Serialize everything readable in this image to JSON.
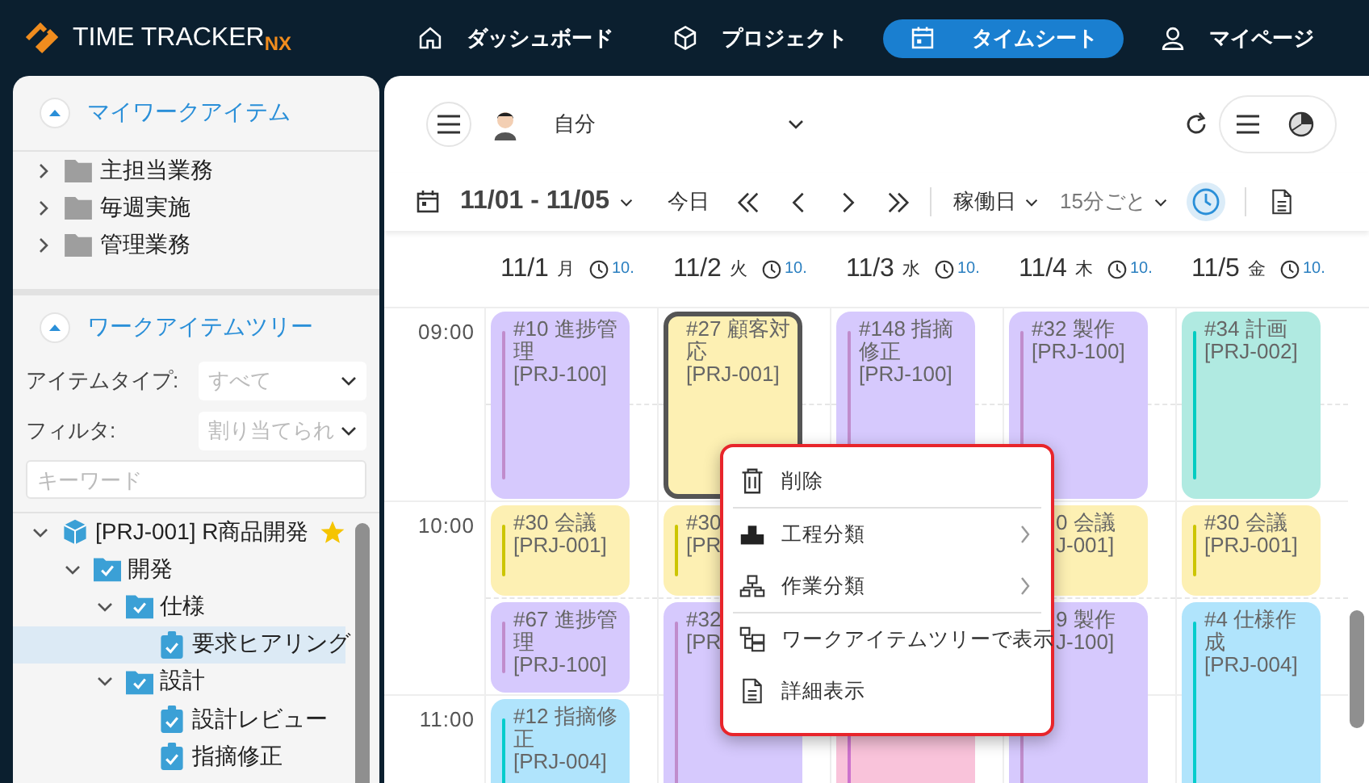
{
  "logo": {
    "name": "TIME TRACKER",
    "suffix": "NX"
  },
  "nav": [
    {
      "label": "ダッシュボード",
      "kind": "home",
      "selected": false
    },
    {
      "label": "プロジェクト",
      "kind": "cube",
      "selected": false
    },
    {
      "label": "タイムシート",
      "kind": "calendar",
      "selected": true
    },
    {
      "label": "マイページ",
      "kind": "user",
      "selected": false
    }
  ],
  "sidebar": {
    "my_items": {
      "title": "マイワークアイテム",
      "expanded": true,
      "items": [
        {
          "label": "主担当業務",
          "kind": "folder",
          "expanded": false
        },
        {
          "label": "毎週実施",
          "kind": "folder",
          "expanded": false
        },
        {
          "label": "管理業務",
          "kind": "folder",
          "expanded": false
        }
      ]
    },
    "tree": {
      "title": "ワークアイテムツリー",
      "expanded": true,
      "item_type": {
        "label": "アイテムタイプ:",
        "placeholder": "すべて"
      },
      "filter": {
        "label": "フィルタ:",
        "placeholder": "割り当てられ"
      },
      "keyword": {
        "placeholder": "キーワード"
      },
      "items": [
        {
          "label": "[PRJ-001] R商品開発",
          "kind": "project",
          "expanded": true,
          "favorite": true,
          "selected": false,
          "children": [
            {
              "label": "開発",
              "kind": "folder",
              "expanded": true,
              "favorite": false,
              "selected": false,
              "children": [
                {
                  "label": "仕様",
                  "kind": "folder",
                  "expanded": true,
                  "favorite": false,
                  "selected": false,
                  "children": [
                    {
                      "label": "要求ヒアリング",
                      "kind": "task",
                      "favorite": false,
                      "selected": true
                    }
                  ]
                },
                {
                  "label": "設計",
                  "kind": "folder",
                  "expanded": true,
                  "favorite": false,
                  "selected": false,
                  "children": [
                    {
                      "label": "設計レビュー",
                      "kind": "task",
                      "favorite": false,
                      "selected": false
                    },
                    {
                      "label": "指摘修正",
                      "kind": "task",
                      "favorite": false,
                      "selected": false
                    }
                  ]
                }
              ]
            }
          ]
        }
      ]
    }
  },
  "toolbar": {
    "user": "自分",
    "range": "11/01 - 11/05",
    "today": "今日",
    "days_mode": "稼働日",
    "interval": "15分ごと",
    "time_view_on": true
  },
  "calendar": {
    "times": [
      "09:00",
      "10:00",
      "11:00"
    ],
    "days": [
      {
        "date": "11/1",
        "weekday": "月",
        "total": "10.",
        "events": [
          {
            "title": "#10 進捗管理",
            "code": "[PRJ-100]",
            "color": "#d6c9fd",
            "kind": "hour",
            "selected": false
          },
          {
            "title": "#30 会議",
            "code": "[PRJ-001]",
            "color": "#fdf0b3",
            "kind": "half",
            "selected": false
          },
          {
            "title": "#67 進捗管理",
            "code": "[PRJ-100]",
            "color": "#d6c9fd",
            "kind": "half",
            "selected": false
          },
          {
            "title": "#12 指摘修正",
            "code": "[PRJ-004]",
            "color": "#b0e4fc",
            "kind": "hour",
            "selected": false
          }
        ]
      },
      {
        "date": "11/2",
        "weekday": "火",
        "total": "10.",
        "events": [
          {
            "title": "#27 顧客対応",
            "code": "[PRJ-001]",
            "color": "#fdf0b3",
            "kind": "hour",
            "selected": true
          },
          {
            "title": "#30",
            "code": "[PR",
            "color": "#fdf0b3",
            "kind": "half",
            "selected": false
          },
          {
            "title": "#32",
            "code": "[PR",
            "color": "#d6c9fd",
            "kind": "long",
            "selected": false
          }
        ]
      },
      {
        "date": "11/3",
        "weekday": "水",
        "total": "10.",
        "events": [
          {
            "title": "#148 指摘修正",
            "code": "[PRJ-100]",
            "color": "#d6c9fd",
            "kind": "hour",
            "selected": false
          },
          {
            "color": "#f9c3da",
            "kind": "long",
            "selected": false
          }
        ]
      },
      {
        "date": "11/4",
        "weekday": "木",
        "total": "10.",
        "events": [
          {
            "title": "#32 製作",
            "code": "[PRJ-100]",
            "color": "#d6c9fd",
            "kind": "hour",
            "selected": false
          },
          {
            "title": "0 会議",
            "code": "J-001]",
            "color": "#fdf0b3",
            "kind": "half",
            "selected": false,
            "covered": true
          },
          {
            "title": "9 製作",
            "code": "J-100]",
            "color": "#d6c9fd",
            "kind": "long",
            "selected": false,
            "covered": true
          }
        ]
      },
      {
        "date": "11/5",
        "weekday": "金",
        "total": "10.",
        "events": [
          {
            "title": "#34 計画",
            "code": "[PRJ-002]",
            "color": "#b0eae1",
            "kind": "hour",
            "selected": false
          },
          {
            "title": "#30 会議",
            "code": "[PRJ-001]",
            "color": "#fdf0b3",
            "kind": "half",
            "selected": false
          },
          {
            "title": "#4 仕様作成",
            "code": "[PRJ-004]",
            "color": "#b0e4fc",
            "kind": "long",
            "selected": false
          }
        ]
      }
    ]
  },
  "context_menu": {
    "items": [
      {
        "label": "削除",
        "kind": "trash",
        "submenu": false,
        "divider_after": true
      },
      {
        "label": "工程分類",
        "kind": "process",
        "submenu": true,
        "divider_after": false
      },
      {
        "label": "作業分類",
        "kind": "work",
        "submenu": true,
        "divider_after": true
      },
      {
        "label": "ワークアイテムツリーで表示",
        "kind": "tree",
        "submenu": false,
        "divider_after": false
      },
      {
        "label": "詳細表示",
        "kind": "doc",
        "submenu": false,
        "divider_after": false
      }
    ]
  }
}
